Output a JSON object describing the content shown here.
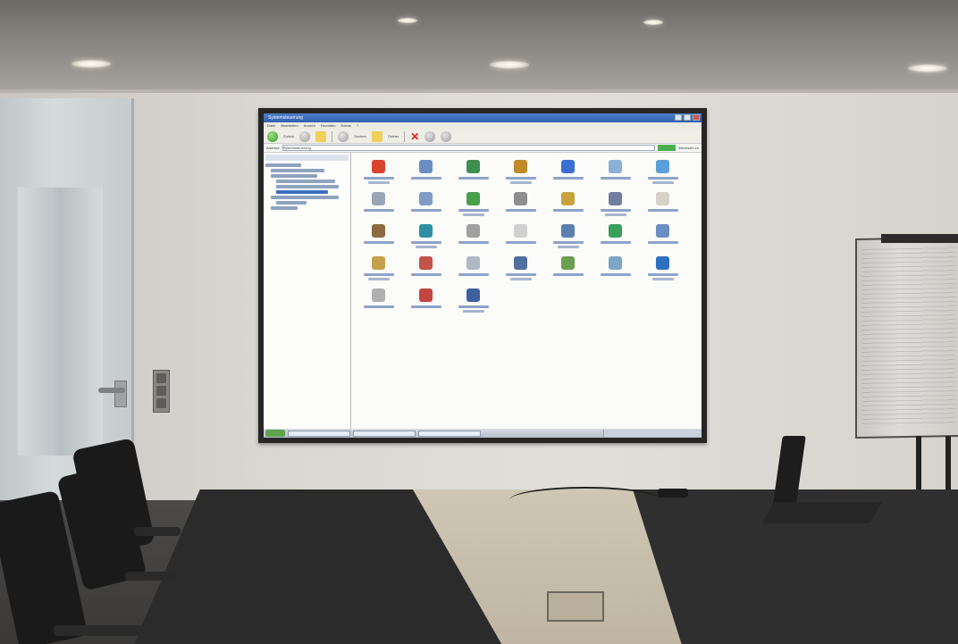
{
  "scene": {
    "description_tags": [
      "conference-room",
      "projection-screen",
      "flipchart",
      "meeting-table"
    ]
  },
  "projected_window": {
    "title": "Systemsteuerung",
    "menu": [
      "Datei",
      "Bearbeiten",
      "Ansicht",
      "Favoriten",
      "Extras",
      "?"
    ],
    "toolbar": {
      "back_label": "Zurück",
      "search_label": "Suchen",
      "folders_label": "Ordner"
    },
    "address_label": "Adresse",
    "address_value": "Systemsteuerung",
    "go_label": "Wechseln zu",
    "icon_count": 31,
    "accent_colors": {
      "titlebar": "#2f5fb0",
      "start": "#5fa34f"
    }
  }
}
